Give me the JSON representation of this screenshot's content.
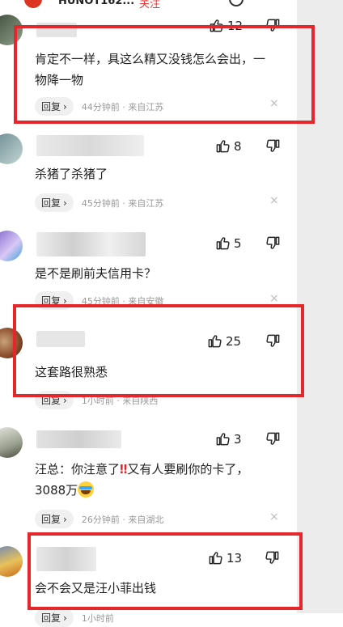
{
  "topbar": {
    "username": "HUNOT162...",
    "follow_label": "关注",
    "partial_likes": "12"
  },
  "comments": [
    {
      "likes": "",
      "text": "肯定不一样，具这么精又没钱怎么会出，一物降一物",
      "reply_label": "回复",
      "time": "44分钟前 · 来自江苏"
    },
    {
      "likes": "8",
      "text": "杀猪了杀猪了",
      "reply_label": "回复",
      "time": "45分钟前 · 来自江苏"
    },
    {
      "likes": "5",
      "text": "是不是刷前夫信用卡？",
      "reply_label": "回复",
      "time": "45分钟前 · 来自安徽"
    },
    {
      "likes": "25",
      "text": "这套路很熟悉",
      "reply_label": "回复",
      "time": "1小时前 · 来自陕西"
    },
    {
      "likes": "3",
      "text_before": "汪总：你注意了",
      "text_warn": "‼",
      "text_after": "又有人要刷你的卡了，3088万",
      "reply_label": "回复",
      "time": "26分钟前 · 来自湖北"
    },
    {
      "likes": "13",
      "text": "会不会又是汪小菲出钱",
      "reply_label": "回复",
      "time": "1小时前"
    }
  ],
  "icons": {
    "like": "thumbs-up-icon",
    "dislike": "thumbs-down-icon",
    "close": "close-icon",
    "reply_arrow": "chevron-right-icon"
  },
  "colors": {
    "highlight": "#e5262b",
    "accent": "#e33"
  },
  "close_glyph": "×",
  "chevron_glyph": "›"
}
